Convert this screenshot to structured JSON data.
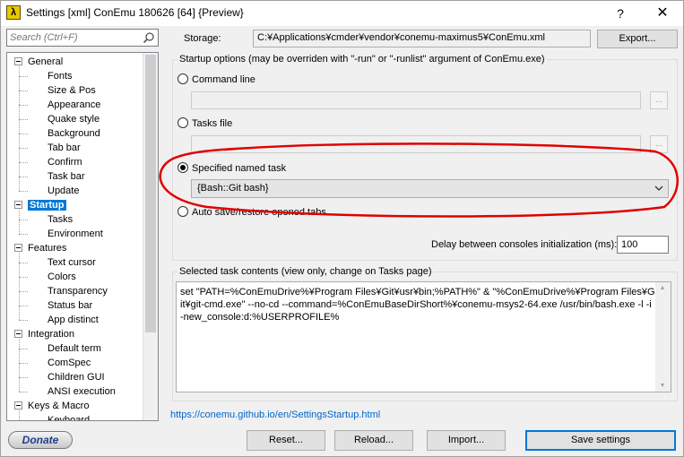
{
  "window": {
    "title": "Settings [xml] ConEmu 180626 [64] {Preview}",
    "app_icon_glyph": "λ",
    "help_glyph": "?",
    "close_glyph": "✕"
  },
  "search": {
    "placeholder": "Search (Ctrl+F)",
    "icon": "search-icon"
  },
  "tree": {
    "items": [
      {
        "label": "General",
        "level": 0
      },
      {
        "label": "Fonts",
        "level": 1
      },
      {
        "label": "Size & Pos",
        "level": 1
      },
      {
        "label": "Appearance",
        "level": 1
      },
      {
        "label": "Quake style",
        "level": 1
      },
      {
        "label": "Background",
        "level": 1
      },
      {
        "label": "Tab bar",
        "level": 1
      },
      {
        "label": "Confirm",
        "level": 1
      },
      {
        "label": "Task bar",
        "level": 1
      },
      {
        "label": "Update",
        "level": 1
      },
      {
        "label": "Startup",
        "level": 0,
        "selected": true
      },
      {
        "label": "Tasks",
        "level": 1
      },
      {
        "label": "Environment",
        "level": 1
      },
      {
        "label": "Features",
        "level": 0
      },
      {
        "label": "Text cursor",
        "level": 1
      },
      {
        "label": "Colors",
        "level": 1
      },
      {
        "label": "Transparency",
        "level": 1
      },
      {
        "label": "Status bar",
        "level": 1
      },
      {
        "label": "App distinct",
        "level": 1
      },
      {
        "label": "Integration",
        "level": 0
      },
      {
        "label": "Default term",
        "level": 1
      },
      {
        "label": "ComSpec",
        "level": 1
      },
      {
        "label": "Children GUI",
        "level": 1
      },
      {
        "label": "ANSI execution",
        "level": 1
      },
      {
        "label": "Keys & Macro",
        "level": 0
      },
      {
        "label": "Keyboard",
        "level": 1
      }
    ]
  },
  "donate_label": "Donate",
  "storage": {
    "label": "Storage:",
    "path": "C:¥Applications¥cmder¥vendor¥conemu-maximus5¥ConEmu.xml",
    "export_label": "Export..."
  },
  "startup": {
    "group_title": "Startup options (may be overriden with \"-run\" or \"-runlist\" argument of ConEmu.exe)",
    "options": {
      "command_line": "Command line",
      "tasks_file": "Tasks file",
      "named_task": "Specified named task",
      "auto_save": "Auto save/restore opened tabs"
    },
    "selected_option": "named_task",
    "browse_label": "...",
    "named_task_value": "{Bash::Git bash}",
    "delay_label": "Delay between consoles initialization (ms):",
    "delay_value": "100"
  },
  "task_contents": {
    "group_title": "Selected task contents (view only, change on Tasks page)",
    "text": "set \"PATH=%ConEmuDrive%¥Program Files¥Git¥usr¥bin;%PATH%\" & \"%ConEmuDrive%¥Program Files¥Git¥git-cmd.exe\" --no-cd --command=%ConEmuBaseDirShort%¥conemu-msys2-64.exe /usr/bin/bash.exe -l -i -new_console:d:%USERPROFILE%"
  },
  "help_link": "https://conemu.github.io/en/SettingsStartup.html",
  "buttons": {
    "reset": "Reset...",
    "reload": "Reload...",
    "import": "Import...",
    "save": "Save settings"
  },
  "colors": {
    "selection": "#0078d7",
    "annotation": "#e00000",
    "link": "#0066cc"
  }
}
